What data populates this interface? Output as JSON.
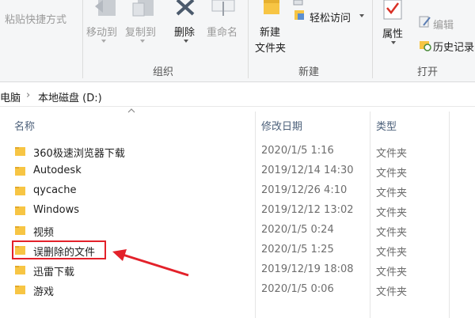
{
  "ribbon": {
    "paste_shortcut": "粘贴快捷方式",
    "move_to": "移动到",
    "copy_to": "复制到",
    "delete": "删除",
    "rename": "重命名",
    "new_folder_line1": "新建",
    "new_folder_line2": "文件夹",
    "easy_access": "轻松访问",
    "properties": "属性",
    "edit": "编辑",
    "history": "历史记录",
    "groups": {
      "organize": "组织",
      "new": "新建",
      "open": "打开"
    }
  },
  "address": {
    "pc": "电脑",
    "separator": "›",
    "drive": "本地磁盘 (D:)"
  },
  "columns": {
    "name": "名称",
    "modified": "修改日期",
    "type": "类型"
  },
  "files": [
    {
      "name": "360极速浏览器下载",
      "modified": "2020/1/5 1:16",
      "type": "文件夹"
    },
    {
      "name": "Autodesk",
      "modified": "2019/12/14 14:30",
      "type": "文件夹"
    },
    {
      "name": "qycache",
      "modified": "2019/12/26 4:10",
      "type": "文件夹"
    },
    {
      "name": "Windows",
      "modified": "2019/12/12 13:02",
      "type": "文件夹"
    },
    {
      "name": "视频",
      "modified": "2020/1/5 0:24",
      "type": "文件夹"
    },
    {
      "name": "误删除的文件",
      "modified": "2020/1/5 1:25",
      "type": "文件夹"
    },
    {
      "name": "迅雷下载",
      "modified": "2019/12/19 18:08",
      "type": "文件夹"
    },
    {
      "name": "游戏",
      "modified": "2020/1/5 0:06",
      "type": "文件夹"
    }
  ],
  "colors": {
    "annotation": "#e3212a",
    "folder": "#f7c544",
    "header_text": "#4c607a"
  }
}
